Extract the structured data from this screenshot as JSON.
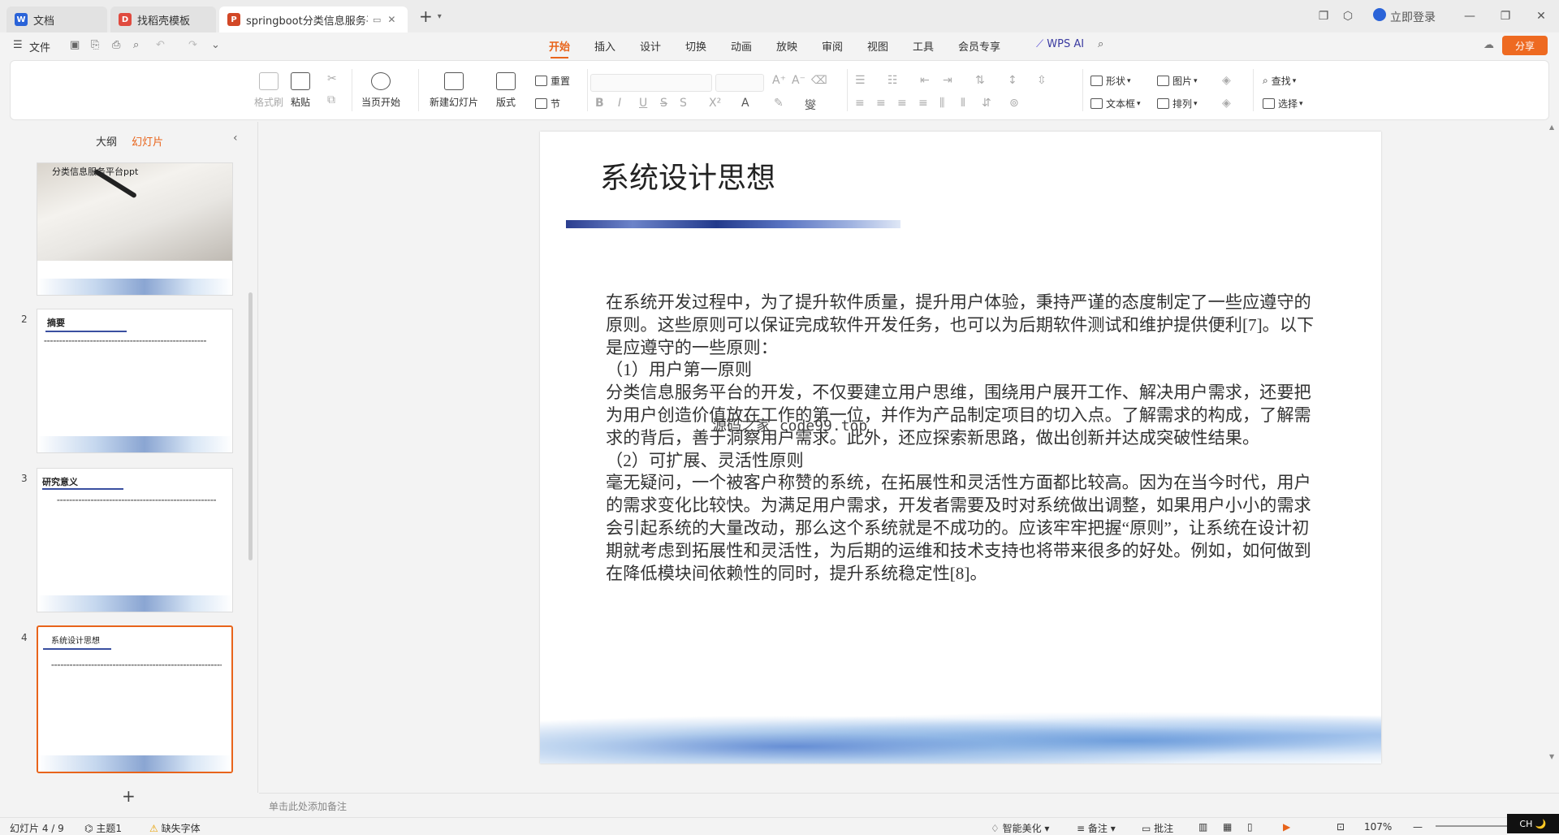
{
  "tabs": [
    {
      "label": "文档",
      "icon": "document-icon",
      "color": "#2a63d8"
    },
    {
      "label": "找稻壳模板",
      "icon": "docer-icon",
      "color": "#e04a3f"
    },
    {
      "label": "springboot分类信息服务平",
      "icon": "ppt-icon",
      "color": "#d24726"
    }
  ],
  "window": {
    "login_label": "立即登录"
  },
  "menu": {
    "file_label": "文件",
    "items": [
      "开始",
      "插入",
      "设计",
      "切换",
      "动画",
      "放映",
      "审阅",
      "视图",
      "工具",
      "会员专享"
    ],
    "active": "开始",
    "wps_ai_label": "WPS AI",
    "share_label": "分享"
  },
  "ribbon": {
    "format_painter": "格式刷",
    "paste": "粘贴",
    "play_from_current": "当页开始",
    "new_slide": "新建幻灯片",
    "layout": "版式",
    "reset": "重置",
    "section": "节",
    "shape": "形状",
    "picture": "图片",
    "find": "查找",
    "textbox": "文本框",
    "arrange": "排列",
    "select": "选择"
  },
  "left_panel": {
    "tab_outline": "大纲",
    "tab_slides": "幻灯片",
    "active_tab": "幻灯片",
    "slides": [
      {
        "num": "",
        "title": "分类信息服务平台ppt"
      },
      {
        "num": "2",
        "title": "摘要"
      },
      {
        "num": "3",
        "title": "研究意义"
      },
      {
        "num": "4",
        "title": "系统设计思想"
      }
    ],
    "add_label": "+"
  },
  "slide": {
    "title": "系统设计思想",
    "paragraphs": [
      "在系统开发过程中，为了提升软件质量，提升用户体验，秉持严谨的态度制定了一些应遵守的原则。这些原则可以保证完成软件开发任务，也可以为后期软件测试和维护提供便利[7]。以下是应遵守的一些原则：",
      "（1）用户第一原则",
      "分类信息服务平台的开发，不仅要建立用户思维，围绕用户展开工作、解决用户需求，还要把为用户创造价值放在工作的第一位，并作为产品制定项目的切入点。了解需求的构成，了解需求的背后，善于洞察用户需求。此外，还应探索新思路，做出创新并达成突破性结果。",
      "（2）可扩展、灵活性原则",
      "毫无疑问，一个被客户称赞的系统，在拓展性和灵活性方面都比较高。因为在当今时代，用户的需求变化比较快。为满足用户需求，开发者需要及时对系统做出调整，如果用户小小的需求会引起系统的大量改动，那么这个系统就是不成功的。应该牢牢把握“原则”，让系统在设计初期就考虑到拓展性和灵活性，为后期的运维和技术支持也将带来很多的好处。例如，如何做到在降低模块间依赖性的同时，提升系统稳定性[8]。"
    ],
    "watermark": "源码之家 code99.top"
  },
  "notes_placeholder": "单击此处添加备注",
  "status": {
    "slide_index": "幻灯片 4 / 9",
    "theme": "主题1",
    "missing_font": "缺失字体",
    "smart_beautify": "智能美化",
    "notes": "备注",
    "comments": "批注",
    "zoom": "107%",
    "ime": "CH 🌙"
  }
}
